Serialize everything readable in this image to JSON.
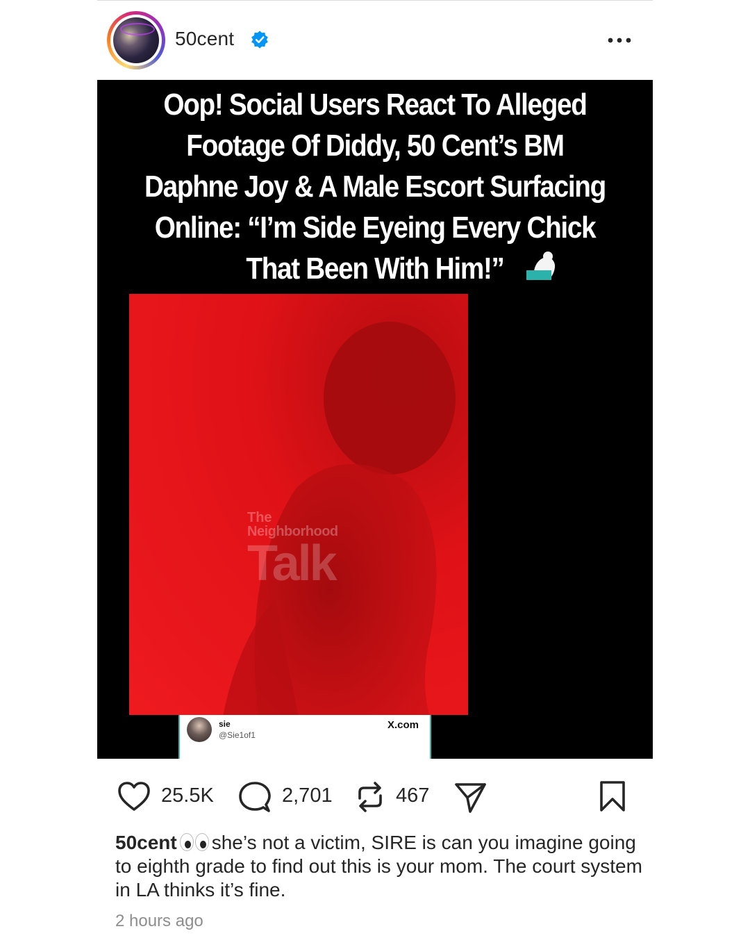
{
  "post": {
    "username": "50cent",
    "verified": true,
    "more_icon": "more-horizontal-icon",
    "image": {
      "headline": "Oop! Social Users React To Alleged Footage Of Diddy, 50 Cent’s BM Daphne Joy & A Male Escort Surfacing Online: “I’m Side Eyeing Every Chick That Been With Him!”",
      "headline_lines": [
        "Oop! Social Users React To Alleged",
        "Footage Of Diddy, 50 Cent’s BM",
        "Daphne Joy & A Male Escort Surfacing",
        "Online: “I’m Side Eyeing Every Chick",
        "That Been With Him!”"
      ],
      "watermark": {
        "line1": "The",
        "line2": "Neighborhood",
        "line3": "Talk"
      },
      "tweet_card": {
        "name": "sie",
        "handle": "@Sie1of1",
        "source": "X.com"
      }
    },
    "actions": {
      "likes": "25.5K",
      "comments": "2,701",
      "reposts": "467"
    },
    "caption": {
      "username": "50cent",
      "text": "she’s not a victim, SIRE is can you imagine going to eighth grade to find out this is your mom. The court system in LA thinks it’s fine."
    },
    "timestamp": "2 hours ago"
  },
  "colors": {
    "verified_blue": "#0095f6",
    "photo_red": "#e81419",
    "accent_teal": "#3fb7b0"
  }
}
